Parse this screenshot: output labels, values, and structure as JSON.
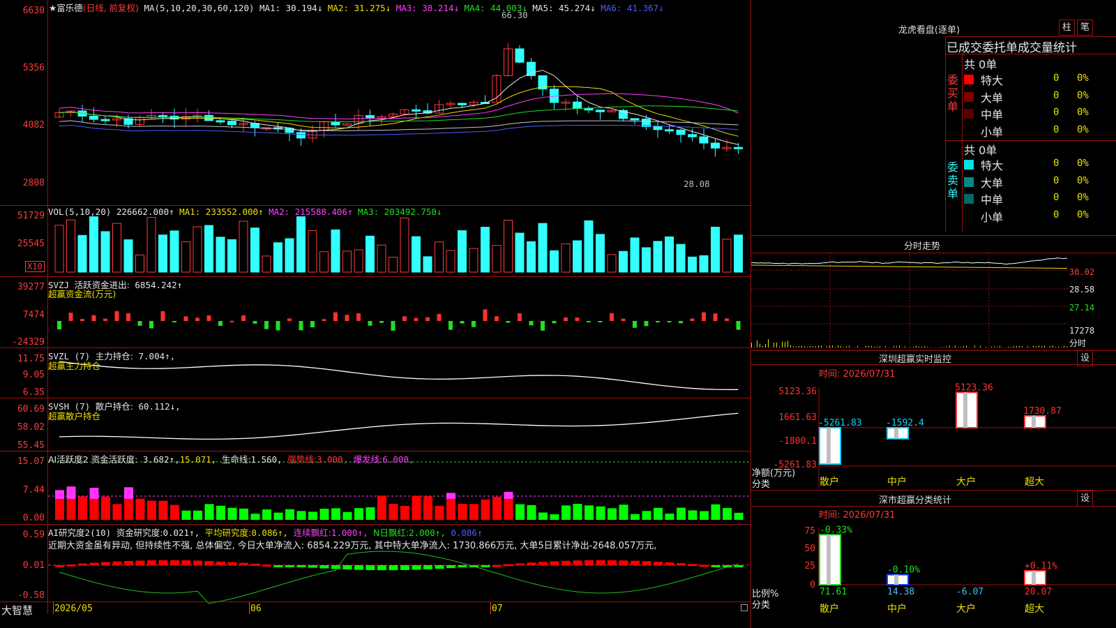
{
  "kline": {
    "stock_name": "★富乐德",
    "period": "(日线, 前复权)",
    "ma_param": "MA(5,10,20,30,60,120)",
    "ma": [
      {
        "label": "MA1:",
        "value": "30.194↓",
        "color": "#e6e6e6"
      },
      {
        "label": "MA2:",
        "value": "31.275↓",
        "color": "#f0e000"
      },
      {
        "label": "MA3:",
        "value": "38.214↓",
        "color": "#ff40ff"
      },
      {
        "label": "MA4:",
        "value": "44.003↓",
        "color": "#20e020"
      },
      {
        "label": "MA5:",
        "value": "45.274↓",
        "color": "#e6e6e6"
      },
      {
        "label": "MA6:",
        "value": "41.367↓",
        "color": "#4d5cff"
      }
    ],
    "y_labels": [
      "6630",
      "5356",
      "4082",
      "2808"
    ],
    "high_label": "66.30",
    "low_label": "28.08"
  },
  "vol": {
    "param": "VOL(5,10,20)",
    "value": "226662.000↑",
    "ma": [
      {
        "label": "MA1:",
        "value": "233552.000↑",
        "color": "#f0e000"
      },
      {
        "label": "MA2:",
        "value": "215588.406↑",
        "color": "#ff40ff"
      },
      {
        "label": "MA3:",
        "value": "203492.750↓",
        "color": "#20e020"
      }
    ],
    "y_labels": [
      "51729",
      "25545"
    ],
    "unit": "X10"
  },
  "svzj": {
    "name": "SVZJ",
    "title": "活跃资金进出:",
    "value": "6854.242↑",
    "sub": "超赢资金流(万元)",
    "y_labels": [
      "39277",
      "7474",
      "-24329"
    ]
  },
  "svzl": {
    "name": "SVZL (7)",
    "title": "主力持仓:",
    "value": "7.004↑,",
    "sub": "超赢主力持仓",
    "y_labels": [
      "11.75",
      "9.05",
      "6.35"
    ]
  },
  "svsh": {
    "name": "SVSH (7)",
    "title": "散户持仓:",
    "value": "60.112↓,",
    "sub": "超赢散户持仓",
    "y_labels": [
      "60.69",
      "58.02",
      "55.45"
    ]
  },
  "ai1": {
    "title": "AI活跃度2 资金活跃度:",
    "value": "3.682↑,",
    "v2": "15.071,",
    "life": "生命线:",
    "life_v": "1.560,",
    "strong": "强势线:",
    "strong_v": "3.000,",
    "burst": "爆发线:",
    "burst_v": "6.000,",
    "y_labels": [
      "15.07",
      "7.44",
      "0.00"
    ]
  },
  "ai2": {
    "title": "AI研究度2(10)",
    "deg": "资金研究度:",
    "deg_v": "0.021↑,",
    "avg": "平均研究度:",
    "avg_v": "0.086↑,",
    "cont": "连续飘红:",
    "cont_v": "1.000↑,",
    "nday": "N日飘红:",
    "nday_v": "2.000↑,",
    "last": "0.086↑",
    "comment": "近期大资金虽有异动, 但持续性不强, 总体偏空, 今日大单净流入: 6854.229万元, 其中特大单净流入: 1730.866万元, 大单5日累计净出-2648.057万元,",
    "y_labels": [
      "0.59",
      "0.01",
      "-0.58"
    ]
  },
  "xaxis": {
    "brand": "大智慧",
    "dates": [
      "2026/05",
      "06",
      "07"
    ]
  },
  "dragon": {
    "title": "龙虎看盘(逐单)",
    "btn_col": "柱",
    "btn_pen": "笔",
    "tabs": "已成交委托单成交量统计",
    "buy": {
      "side": "委买单",
      "total": "共 0单",
      "rows": [
        {
          "label": "特大",
          "v": "0",
          "pct": "0%",
          "color": "#ff0000"
        },
        {
          "label": "大单",
          "v": "0",
          "pct": "0%",
          "color": "#800000"
        },
        {
          "label": "中单",
          "v": "0",
          "pct": "0%",
          "color": "#5a0000"
        },
        {
          "label": "小单",
          "v": "0",
          "pct": "0%",
          "color": "#000000"
        }
      ]
    },
    "sell": {
      "side": "委卖单",
      "total": "共 0单",
      "rows": [
        {
          "label": "特大",
          "v": "0",
          "pct": "0%",
          "color": "#00e5e5"
        },
        {
          "label": "大单",
          "v": "0",
          "pct": "0%",
          "color": "#008a8a"
        },
        {
          "label": "中单",
          "v": "0",
          "pct": "0%",
          "color": "#006a6a"
        },
        {
          "label": "小单",
          "v": "0",
          "pct": "0%",
          "color": "#000000"
        }
      ]
    }
  },
  "intraday": {
    "title": "分时走势",
    "labels": [
      "30.02",
      "28.58",
      "27.14",
      "17278",
      "分时"
    ]
  },
  "monitor": {
    "title": "深圳超赢实时监控",
    "gear": "设",
    "time": "时间: 2026/07/31",
    "y_labels": [
      "5123.36",
      "1661.63",
      "-1800.1",
      "-5261.83"
    ],
    "axis_title": "净额(万元)",
    "axis_sub": "分类",
    "bars": [
      {
        "cat": "散户",
        "value": "-5261.83",
        "color": "#00d8ff"
      },
      {
        "cat": "中户",
        "value": "-1592.4",
        "color": "#00d8ff"
      },
      {
        "cat": "大户",
        "value": "5123.36",
        "color": "#ff3030"
      },
      {
        "cat": "超大",
        "value": "1730.87",
        "color": "#ff3030"
      }
    ]
  },
  "stats": {
    "title": "深市超赢分类统计",
    "gear": "设",
    "time": "时间: 2026/07/31",
    "y_labels": [
      "75",
      "50",
      "25",
      "0"
    ],
    "axis_title": "比例%",
    "axis_sub": "分类",
    "bars": [
      {
        "cat": "散户",
        "pct": "-0.33%",
        "value": "71.61",
        "pct_color": "#20e020"
      },
      {
        "cat": "中户",
        "pct": "-0.10%",
        "value": "14.38",
        "pct_color": "#20e020"
      },
      {
        "cat": "大户",
        "pct": "",
        "value": "-6.07",
        "pct_color": "#ff3030"
      },
      {
        "cat": "超大",
        "pct": "+0.11%",
        "value": "20.07",
        "pct_color": "#ff3030"
      }
    ]
  }
}
